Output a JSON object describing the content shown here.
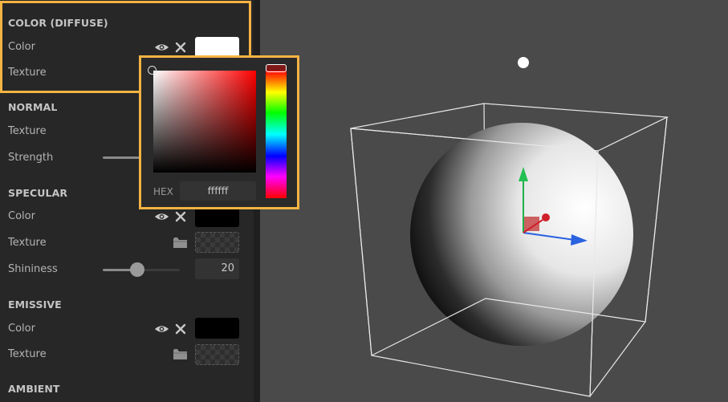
{
  "panel": {
    "diffuse": {
      "title": "COLOR (DIFFUSE)",
      "color_label": "Color",
      "texture_label": "Texture",
      "color_value": "#ffffff"
    },
    "normal": {
      "title": "NORMAL",
      "texture_label": "Texture",
      "strength_label": "Strength"
    },
    "specular": {
      "title": "SPECULAR",
      "color_label": "Color",
      "texture_label": "Texture",
      "shininess_label": "Shininess",
      "shininess_value": "20",
      "color_value": "#000000",
      "shininess_level": 0.45
    },
    "emissive": {
      "title": "EMISSIVE",
      "color_label": "Color",
      "texture_label": "Texture",
      "color_value": "#000000"
    },
    "ambient": {
      "title": "AMBIENT"
    }
  },
  "picker": {
    "hex_label": "HEX",
    "hex_value": "ffffff"
  },
  "colors": {
    "accent_highlight": "#f5b343",
    "panel_bg": "#272727",
    "viewport_bg": "#4a4a4a"
  },
  "icons": [
    "eye-icon",
    "close-icon",
    "folder-icon"
  ]
}
